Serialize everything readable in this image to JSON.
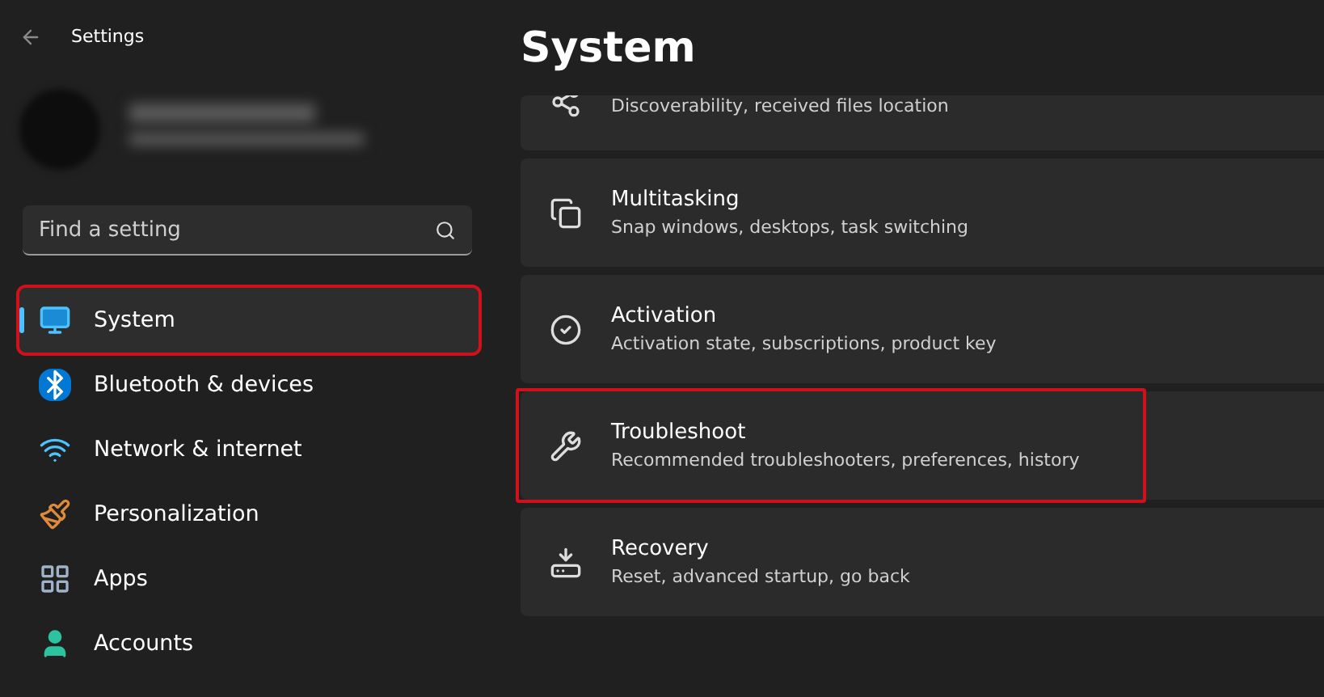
{
  "window": {
    "title": "Settings"
  },
  "search": {
    "placeholder": "Find a setting"
  },
  "nav": [
    {
      "label": "System",
      "selected": true,
      "annotated": true
    },
    {
      "label": "Bluetooth & devices",
      "selected": false,
      "annotated": false
    },
    {
      "label": "Network & internet",
      "selected": false,
      "annotated": false
    },
    {
      "label": "Personalization",
      "selected": false,
      "annotated": false
    },
    {
      "label": "Apps",
      "selected": false,
      "annotated": false
    },
    {
      "label": "Accounts",
      "selected": false,
      "annotated": false
    }
  ],
  "page": {
    "title": "System"
  },
  "cards": [
    {
      "kind": "partial",
      "subtitle": "Discoverability, received files location",
      "annotated": false
    },
    {
      "kind": "full",
      "title": "Multitasking",
      "subtitle": "Snap windows, desktops, task switching",
      "annotated": false
    },
    {
      "kind": "full",
      "title": "Activation",
      "subtitle": "Activation state, subscriptions, product key",
      "annotated": false
    },
    {
      "kind": "full",
      "title": "Troubleshoot",
      "subtitle": "Recommended troubleshooters, preferences, history",
      "annotated": true
    },
    {
      "kind": "full",
      "title": "Recovery",
      "subtitle": "Reset, advanced startup, go back",
      "annotated": false
    }
  ]
}
